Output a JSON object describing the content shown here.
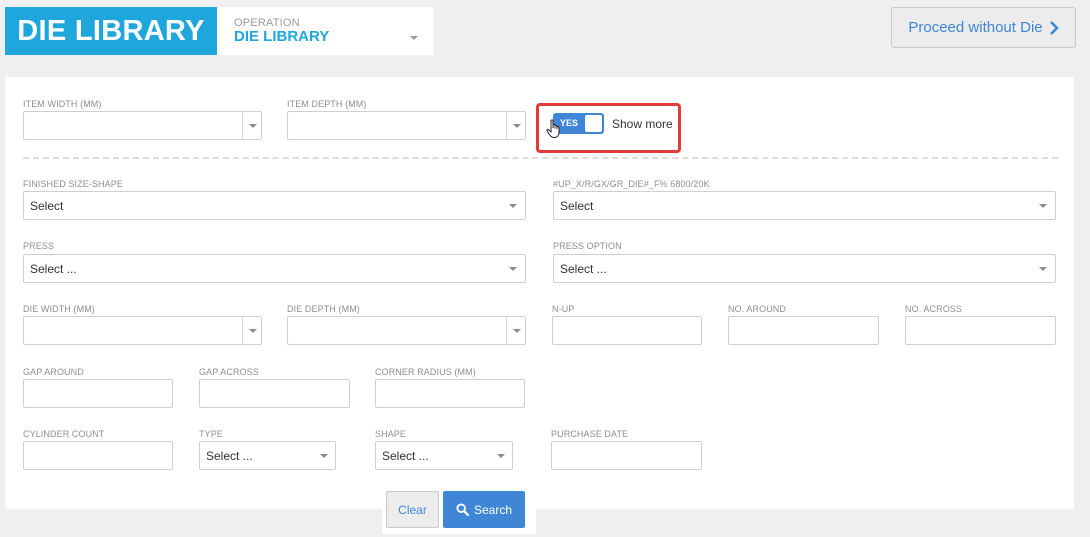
{
  "header": {
    "brand": "DIE LIBRARY",
    "operation_label": "OPERATION",
    "operation_value": "DIE LIBRARY",
    "proceed_label": "Proceed without Die"
  },
  "toggle": {
    "state": "YES",
    "label": "Show more",
    "on": true
  },
  "fields": {
    "item_width": {
      "label": "ITEM WIDTH (MM)",
      "value": ""
    },
    "item_depth": {
      "label": "ITEM DEPTH (MM)",
      "value": ""
    },
    "finished_size_shape": {
      "label": "FINISHED SIZE-SHAPE",
      "value": "Select"
    },
    "up_code": {
      "label": "#UP_X/R/GX/GR_DIE#_F% 6800/20K",
      "value": "Select"
    },
    "press": {
      "label": "PRESS",
      "value": "Select ..."
    },
    "press_option": {
      "label": "PRESS OPTION",
      "value": "Select ..."
    },
    "die_width": {
      "label": "DIE WIDTH (MM)",
      "value": ""
    },
    "die_depth": {
      "label": "DIE DEPTH (MM)",
      "value": ""
    },
    "n_up": {
      "label": "N-UP",
      "value": ""
    },
    "no_around": {
      "label": "NO. AROUND",
      "value": ""
    },
    "no_across": {
      "label": "NO. ACROSS",
      "value": ""
    },
    "gap_around": {
      "label": "GAP AROUND",
      "value": ""
    },
    "gap_across": {
      "label": "GAP ACROSS",
      "value": ""
    },
    "corner_radius": {
      "label": "CORNER RADIUS (MM)",
      "value": ""
    },
    "cylinder_count": {
      "label": "CYLINDER COUNT",
      "value": ""
    },
    "type": {
      "label": "TYPE",
      "value": "Select ..."
    },
    "shape": {
      "label": "SHAPE",
      "value": "Select ..."
    },
    "purchase_date": {
      "label": "PURCHASE DATE",
      "value": ""
    }
  },
  "actions": {
    "clear_label": "Clear",
    "search_label": "Search"
  },
  "icons": {
    "proceed": "chevron-right-icon",
    "search": "search-icon",
    "cursor": "hand-pointer-icon"
  },
  "colors": {
    "brand": "#1ea6dd",
    "accent": "#3f86d6",
    "highlight": "#e03a3a"
  }
}
